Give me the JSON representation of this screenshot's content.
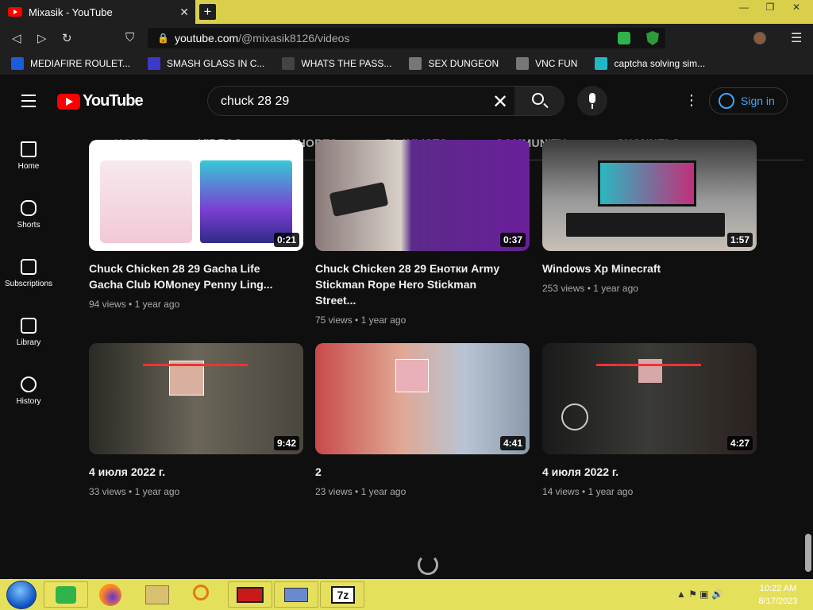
{
  "browser": {
    "tab_title": "Mixasik - YouTube",
    "new_tab": "+",
    "window_controls": [
      "—",
      "❐",
      "✕"
    ],
    "url_host": "youtube.com",
    "url_path": "/@mixasik8126/videos",
    "bookmarks": [
      {
        "label": "MEDIAFIRE ROULET...",
        "icon": "mediafire-icon",
        "color": "#1e5bd8"
      },
      {
        "label": "SMASH GLASS IN C...",
        "icon": "sigma-icon",
        "color": "#3a3acb"
      },
      {
        "label": "WHATS THE PASS...",
        "icon": "hat-icon",
        "color": "#444444"
      },
      {
        "label": "SEX DUNGEON",
        "icon": "badge-icon",
        "color": "#777777"
      },
      {
        "label": "VNC FUN",
        "icon": "badge-icon",
        "color": "#777777"
      },
      {
        "label": "captcha solving sim...",
        "icon": "caret-icon",
        "color": "#1fb8c8"
      }
    ]
  },
  "youtube": {
    "logo": "YouTube",
    "search_value": "chuck 28 29",
    "sign_in": "Sign in",
    "tabs": [
      "HOME",
      "VIDEOS",
      "SHORTS",
      "PLAYLISTS",
      "COMMUNITY",
      "CHANNELS"
    ],
    "active_tab": "VIDEOS",
    "sidebar": [
      "Home",
      "Shorts",
      "Subscriptions",
      "Library",
      "History"
    ],
    "videos": [
      {
        "title": "Chuck Chicken 28 29 Gacha Life Gacha Club ЮMoney Penny Ling...",
        "duration": "0:21",
        "views": "94 views",
        "age": "1 year ago"
      },
      {
        "title": "Chuck Chicken 28 29 Енотки Army Stickman Rope Hero Stickman Street...",
        "duration": "0:37",
        "views": "75 views",
        "age": "1 year ago"
      },
      {
        "title": "Windows Xp Minecraft",
        "duration": "1:57",
        "views": "253 views",
        "age": "1 year ago"
      },
      {
        "title": "4 июля 2022 г.",
        "duration": "9:42",
        "views": "33 views",
        "age": "1 year ago"
      },
      {
        "title": "2",
        "duration": "4:41",
        "views": "23 views",
        "age": "1 year ago"
      },
      {
        "title": "4 июля 2022 г.",
        "duration": "4:27",
        "views": "14 views",
        "age": "1 year ago"
      }
    ]
  },
  "taskbar": {
    "time": "10:22 AM",
    "date": "8/17/2023"
  },
  "colors": {
    "taskbar": "#e5e05c",
    "accent_link": "#3ea6ff",
    "yt_red": "#ff0000"
  }
}
